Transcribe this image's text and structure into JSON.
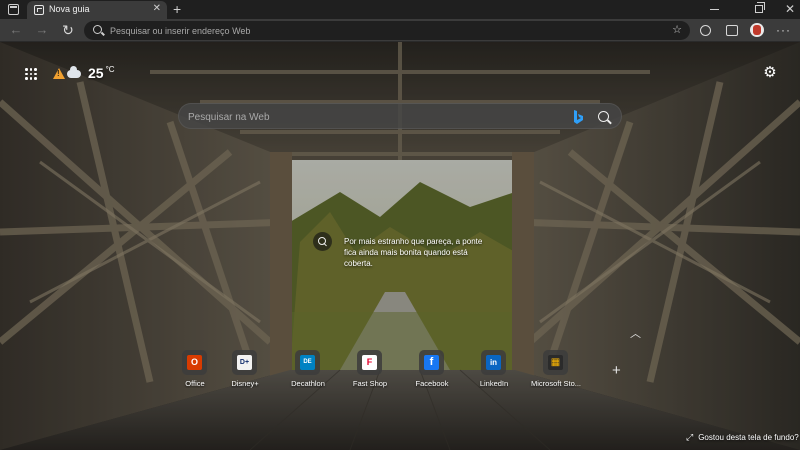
{
  "tab": {
    "title": "Nova guia",
    "close": "✕"
  },
  "toolbar": {
    "address_placeholder": "Pesquisar ou inserir endereço Web",
    "favorites_icon": "star-plus-icon",
    "new_tab": "+",
    "more": "···"
  },
  "weather": {
    "temperature": "25",
    "unit": "°C",
    "alert_icon": "warning-icon",
    "condition_icon": "cloud-icon",
    "alert_color": "#f0a030"
  },
  "search": {
    "placeholder": "Pesquisar na Web"
  },
  "image_caption": "Por mais estranho que pareça, a ponte fica ainda mais bonita quando está coberta.",
  "quick_links": [
    {
      "label": "Office",
      "glyph": "O",
      "color": "#d83b01"
    },
    {
      "label": "Disney+",
      "glyph": "D+",
      "color": "#0f2b6b"
    },
    {
      "label": "Decathlon",
      "glyph": "DE",
      "color": "#0082c3"
    },
    {
      "label": "Fast Shop",
      "glyph": "F",
      "color": "#e4002b"
    },
    {
      "label": "Facebook",
      "glyph": "f",
      "color": "#1877f2"
    },
    {
      "label": "LinkedIn",
      "glyph": "in",
      "color": "#0a66c2"
    },
    {
      "label": "Microsoft Sto...",
      "glyph": "▦",
      "color": "#2b2b2b"
    }
  ],
  "add_link": "+",
  "background_feedback": "Gostou desta tela de fundo?"
}
